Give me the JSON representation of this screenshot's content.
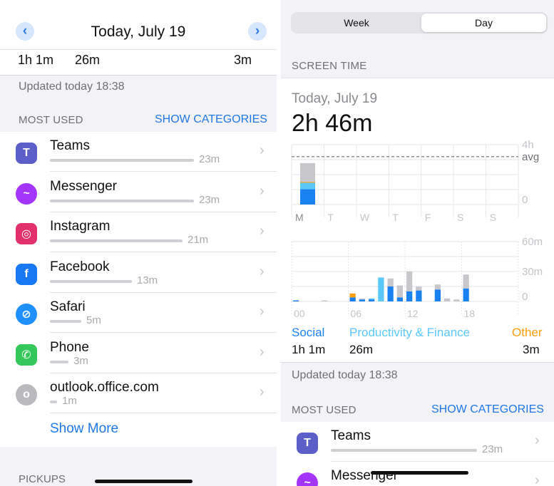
{
  "left": {
    "header": {
      "title": "Today, July 19",
      "prev_icon": "‹",
      "next_icon": "›"
    },
    "category_values": {
      "social": "1h 1m",
      "productivity": "26m",
      "other": "3m"
    },
    "updated": "Updated today 18:38",
    "most_used": {
      "title": "MOST USED",
      "show_categories": "SHOW CATEGORIES"
    },
    "apps": [
      {
        "name": "Teams",
        "value": "23m",
        "icon": "teams-icon",
        "color": "#5b5fc7",
        "glyph": "T",
        "fraction": 1.0
      },
      {
        "name": "Messenger",
        "value": "23m",
        "icon": "messenger-icon",
        "color": "#a334fa",
        "glyph": "~",
        "fraction": 1.0
      },
      {
        "name": "Instagram",
        "value": "21m",
        "icon": "instagram-icon",
        "color": "#e1306c",
        "glyph": "◎",
        "fraction": 0.92
      },
      {
        "name": "Facebook",
        "value": "13m",
        "icon": "facebook-icon",
        "color": "#1877f2",
        "glyph": "f",
        "fraction": 0.57
      },
      {
        "name": "Safari",
        "value": "5m",
        "icon": "safari-icon",
        "color": "#1e90ff",
        "glyph": "⊘",
        "fraction": 0.22
      },
      {
        "name": "Phone",
        "value": "3m",
        "icon": "phone-icon",
        "color": "#34c759",
        "glyph": "✆",
        "fraction": 0.13
      },
      {
        "name": "outlook.office.com",
        "value": "1m",
        "icon": "website-icon",
        "color": "#b9b9be",
        "glyph": "o",
        "fraction": 0.05
      }
    ],
    "show_more": "Show More",
    "pickups": "PICKUPS"
  },
  "right": {
    "segmented": {
      "week": "Week",
      "day": "Day",
      "selected": "Day"
    },
    "screen_time_heading": "SCREEN TIME",
    "date": "Today, July 19",
    "total": "2h 46m",
    "weekly_chart": {
      "type": "bar",
      "categories": [
        "M",
        "T",
        "W",
        "T",
        "F",
        "S",
        "S"
      ],
      "y_ticks": [
        "4h",
        "avg",
        "0"
      ],
      "average_hours": 3.2,
      "ylim": [
        0,
        4
      ],
      "bars": [
        {
          "day": "M",
          "social": 1.02,
          "productivity": 0.43,
          "other": 0.05,
          "uncategorized": 1.27
        }
      ],
      "colors": {
        "social": "#1a82f0",
        "productivity": "#5ac8fa",
        "other": "#ff9f0a",
        "uncategorized": "#c7c7cc"
      }
    },
    "hourly_chart": {
      "type": "bar",
      "x_ticks": [
        "00",
        "06",
        "12",
        "18"
      ],
      "y_ticks": [
        "60m",
        "30m",
        "0"
      ],
      "ylim": [
        0,
        60
      ],
      "bars": [
        {
          "hour": 0,
          "social": 1,
          "productivity": 0,
          "other": 0,
          "uncategorized": 0
        },
        {
          "hour": 3,
          "social": 0,
          "productivity": 0,
          "other": 0,
          "uncategorized": 1
        },
        {
          "hour": 6,
          "social": 4,
          "productivity": 0,
          "other": 4,
          "uncategorized": 0
        },
        {
          "hour": 7,
          "social": 2,
          "productivity": 0,
          "other": 0,
          "uncategorized": 1
        },
        {
          "hour": 8,
          "social": 2,
          "productivity": 1,
          "other": 0,
          "uncategorized": 0
        },
        {
          "hour": 9,
          "social": 0,
          "productivity": 24,
          "other": 0,
          "uncategorized": 0
        },
        {
          "hour": 10,
          "social": 15,
          "productivity": 0,
          "other": 0,
          "uncategorized": 8
        },
        {
          "hour": 11,
          "social": 4,
          "productivity": 0,
          "other": 0,
          "uncategorized": 12
        },
        {
          "hour": 12,
          "social": 10,
          "productivity": 0,
          "other": 0,
          "uncategorized": 20
        },
        {
          "hour": 13,
          "social": 11,
          "productivity": 0,
          "other": 0,
          "uncategorized": 4
        },
        {
          "hour": 15,
          "social": 12,
          "productivity": 0,
          "other": 0,
          "uncategorized": 5
        },
        {
          "hour": 16,
          "social": 0,
          "productivity": 0,
          "other": 0,
          "uncategorized": 3
        },
        {
          "hour": 17,
          "social": 0,
          "productivity": 0,
          "other": 0,
          "uncategorized": 2
        },
        {
          "hour": 18,
          "social": 13,
          "productivity": 0,
          "other": 0,
          "uncategorized": 14
        }
      ]
    },
    "categories": [
      {
        "label": "Social",
        "value": "1h 1m",
        "color": "#1a82f0"
      },
      {
        "label": "Productivity & Finance",
        "value": "26m",
        "color": "#5ac8fa"
      },
      {
        "label": "Other",
        "value": "3m",
        "color": "#ff9f0a"
      }
    ],
    "updated": "Updated today 18:38",
    "most_used": {
      "title": "MOST USED",
      "show_categories": "SHOW CATEGORIES"
    },
    "apps": [
      {
        "name": "Teams",
        "value": "23m",
        "icon": "teams-icon",
        "color": "#5b5fc7",
        "glyph": "T",
        "fraction": 1.0
      },
      {
        "name": "Messenger",
        "value": "",
        "icon": "messenger-icon",
        "color": "#a334fa",
        "glyph": "~",
        "fraction": 1.0
      }
    ]
  }
}
